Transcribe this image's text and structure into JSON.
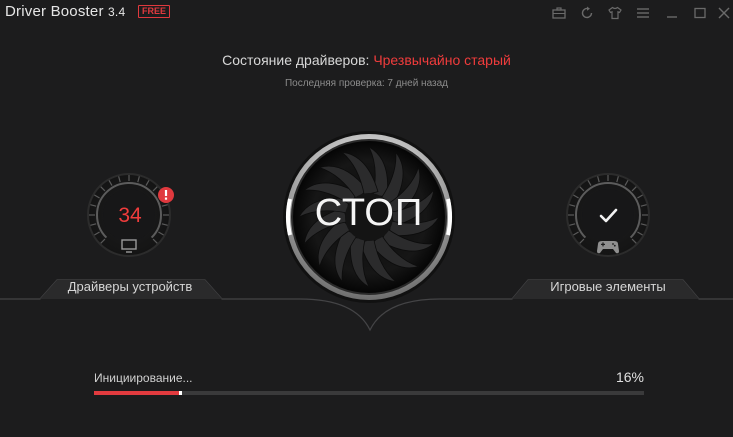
{
  "window": {
    "app_name": "Driver Booster",
    "version": "3.4",
    "edition_badge": "FREE",
    "toolbar_icons": [
      "briefcase-icon",
      "restore-icon",
      "shirt-skin-icon",
      "menu-icon",
      "minimize-icon",
      "maximize-icon",
      "close-icon"
    ]
  },
  "status": {
    "label": "Состояние драйверов:",
    "value": "Чрезвычайно старый",
    "value_color": "#f03c3c",
    "last_check": "Последняя проверка: 7 дней назад"
  },
  "left_gauge": {
    "count": "34",
    "label": "Драйверы устройств",
    "alert_icon": "exclamation-icon",
    "device_icon": "monitor-icon"
  },
  "center_button": {
    "label": "СТОП"
  },
  "right_gauge": {
    "label": "Игровые элементы",
    "status_icon": "checkmark-icon",
    "device_icon": "gamepad-icon"
  },
  "progress": {
    "label": "Инициирование...",
    "percent_text": "16%",
    "fraction": 0.16,
    "accent": "#e23b3f"
  }
}
